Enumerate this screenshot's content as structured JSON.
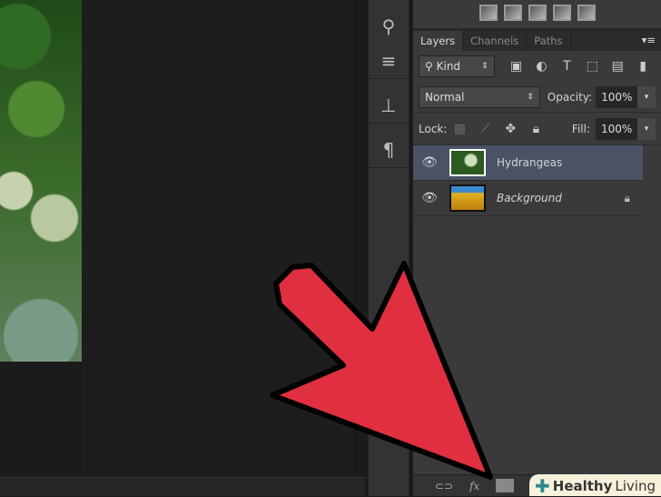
{
  "layers_panel": {
    "tabs": [
      "Layers",
      "Channels",
      "Paths"
    ],
    "filter_kind": "Kind",
    "blend_mode": "Normal",
    "opacity_label": "Opacity:",
    "opacity_value": "100%",
    "lock_label": "Lock:",
    "fill_label": "Fill:",
    "fill_value": "100%",
    "layers": [
      {
        "name": "Hydrangeas",
        "selected": true
      },
      {
        "name": "Background",
        "locked": true
      }
    ]
  },
  "footer": {
    "fx_label": "fx"
  },
  "watermark": {
    "brand_bold": "Healthy",
    "brand_light": "Living"
  },
  "colors": {
    "arrow": "#e03040",
    "selection": "#4a5266"
  }
}
